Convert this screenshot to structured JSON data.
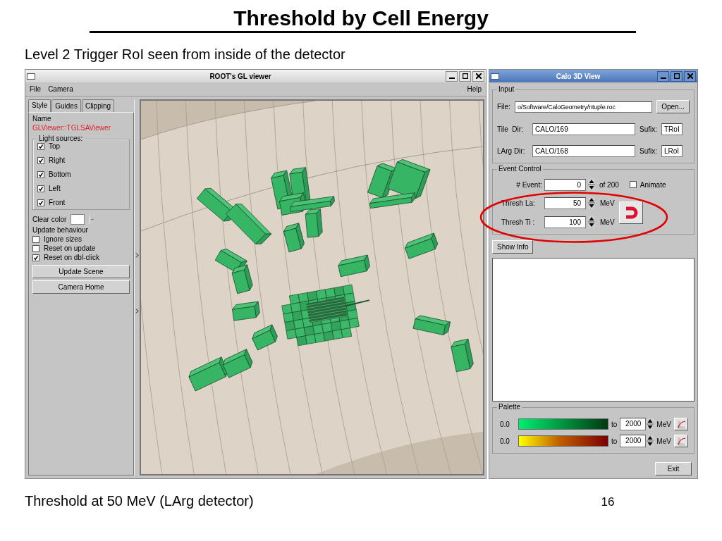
{
  "slide": {
    "title": "Threshold by Cell Energy",
    "subtitle": "Level 2 Trigger RoI seen from inside of the detector",
    "caption": "Threshold at 50 MeV (LArg detector)",
    "page_number": "16"
  },
  "gl_viewer": {
    "title": "ROOT's GL viewer",
    "menu": [
      "File",
      "Camera"
    ],
    "help": "Help",
    "tabs": [
      {
        "label": "Style",
        "selected": true
      },
      {
        "label": "Guides",
        "selected": false
      },
      {
        "label": "Clipping",
        "selected": false
      }
    ],
    "name_label": "Name",
    "name_value": "GLViewer::TGLSAViewer",
    "light_sources": {
      "title": "Light sources:",
      "items": [
        {
          "label": "Top",
          "checked": true
        },
        {
          "label": "Right",
          "checked": true
        },
        {
          "label": "Bottom",
          "checked": true
        },
        {
          "label": "Left",
          "checked": true
        },
        {
          "label": "Front",
          "checked": true
        }
      ]
    },
    "clear_color_label": "Clear color",
    "update_behaviour": {
      "title": "Update behaviour",
      "items": [
        {
          "label": "Ignore sizes",
          "checked": false
        },
        {
          "label": "Reset on update",
          "checked": false
        },
        {
          "label": "Reset on dbl-click",
          "checked": true
        }
      ]
    },
    "buttons": [
      "Update Scene",
      "Camera Home"
    ]
  },
  "calo_view": {
    "title": "Calo 3D View",
    "input": {
      "title": "Input",
      "file_label": "File:",
      "file_value": "o/Software/CaloGeometry/ntuple.roc",
      "open_button": "Open...",
      "rows": [
        {
          "label": "Tile  Dir:",
          "value": "CALO/169",
          "suffix_label": "Sufix:",
          "suffix_value": "TRoI"
        },
        {
          "label": "LArg Dir:",
          "value": "CALO/168",
          "suffix_label": "Sufix:",
          "suffix_value": "LRoI"
        }
      ]
    },
    "event_control": {
      "title": "Event Control",
      "event_label": "# Event:",
      "event_value": "0",
      "event_total": "of 200",
      "animate": {
        "label": "Animate",
        "checked": false
      },
      "thresholds": [
        {
          "label": "Thresh La:",
          "value": "50",
          "unit": "MeV"
        },
        {
          "label": "Thresh Ti :",
          "value": "100",
          "unit": "MeV"
        }
      ]
    },
    "show_info": "Show Info",
    "palette": {
      "title": "Palette",
      "rows": [
        {
          "min": "0.0",
          "to": "to",
          "max": "2000",
          "unit": "MeV"
        },
        {
          "min": "0.0",
          "to": "to",
          "max": "2000",
          "unit": "MeV"
        }
      ]
    },
    "exit": "Exit"
  }
}
